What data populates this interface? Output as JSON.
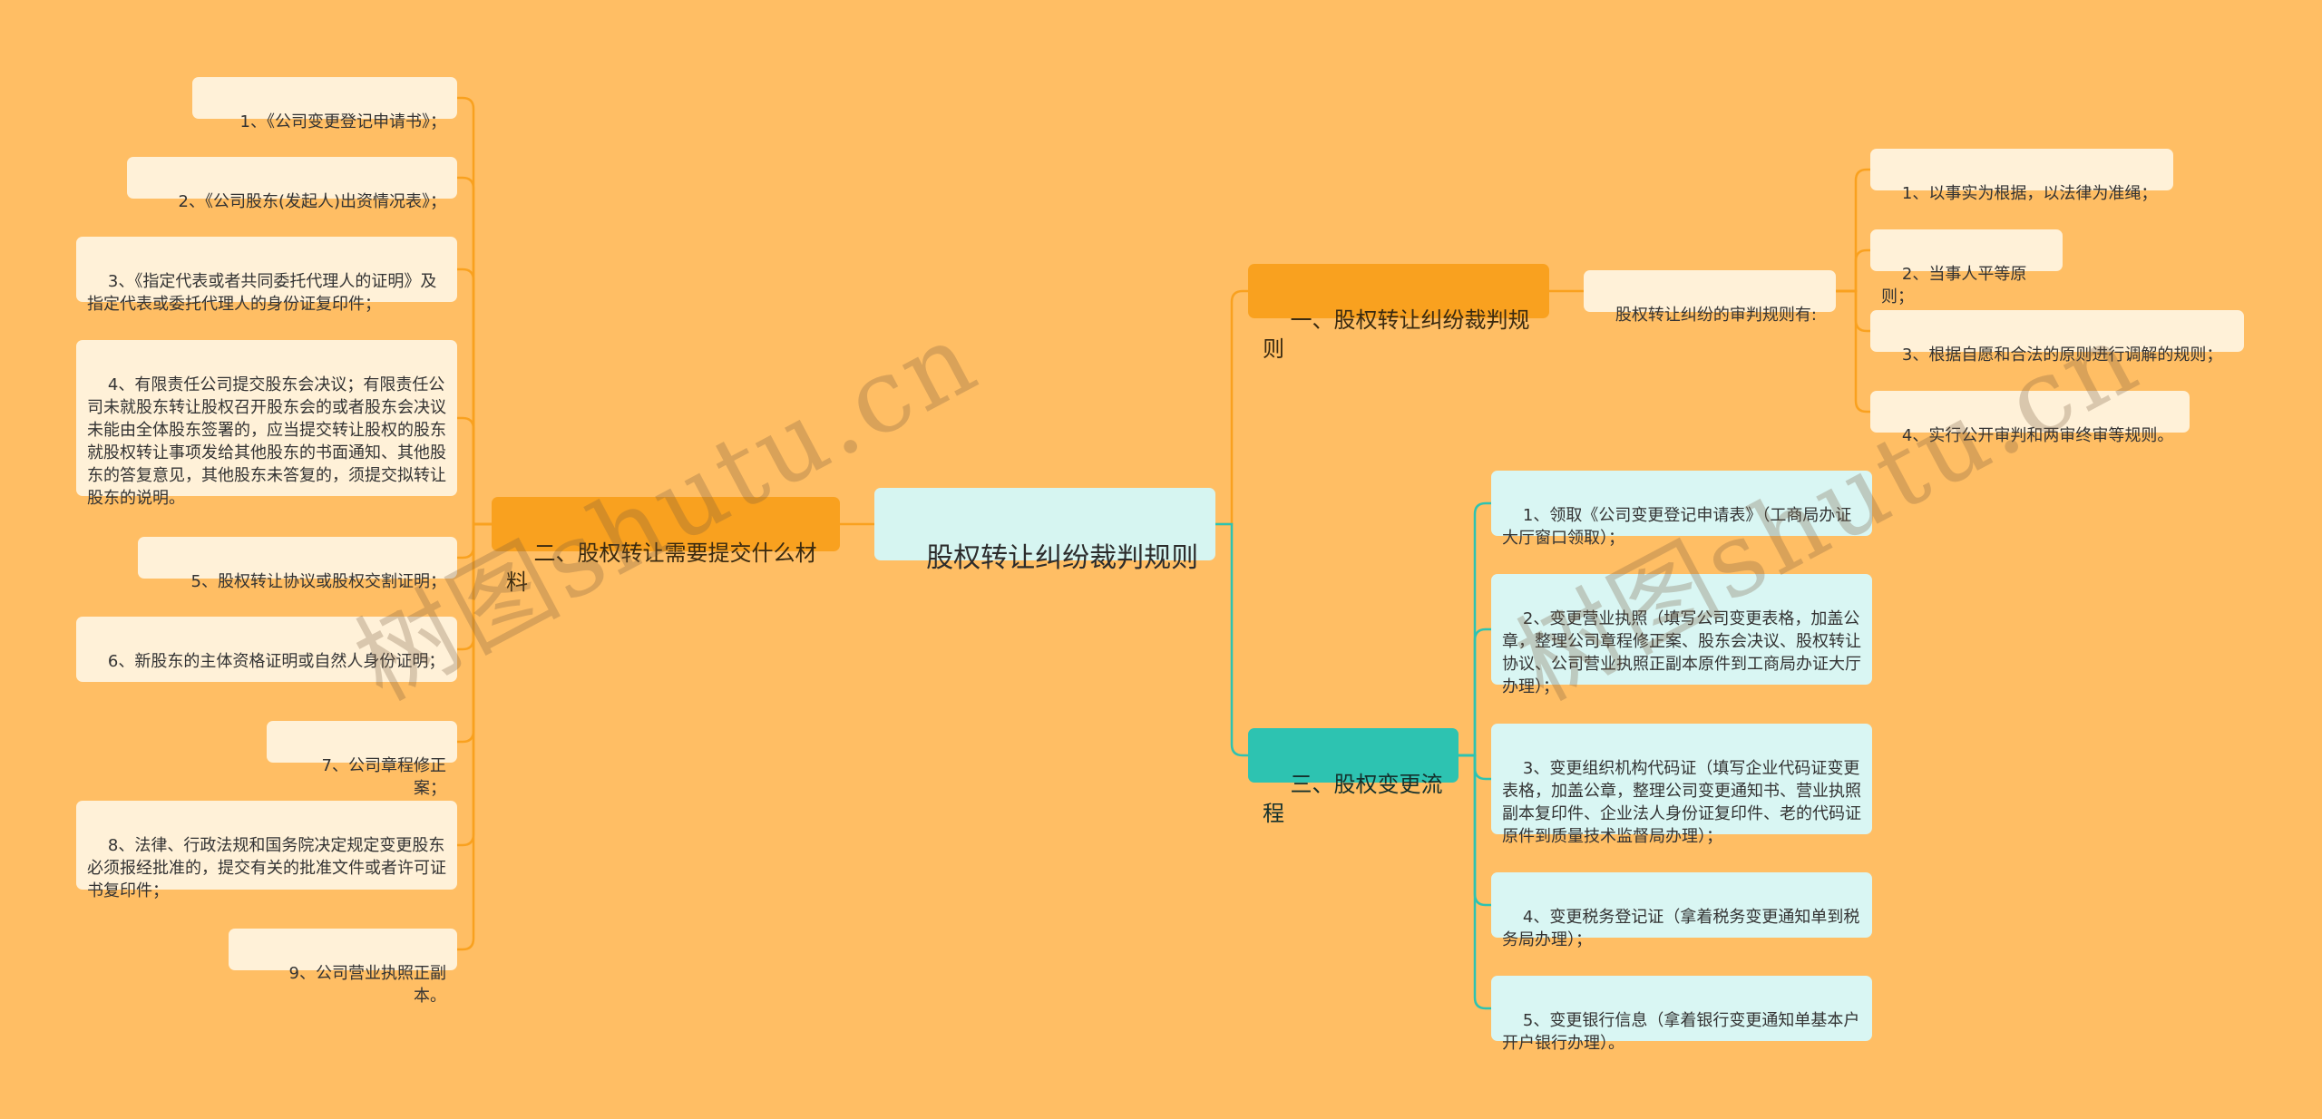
{
  "root": {
    "label": "股权转让纠纷裁判规则"
  },
  "branches": {
    "b1": {
      "label": "一、股权转让纠纷裁判规则",
      "sub": "股权转让纠纷的审判规则有:",
      "items": [
        "1、以事实为根据，以法律为准绳；",
        "2、当事人平等原则；",
        "3、根据自愿和合法的原则进行调解的规则；",
        "4、实行公开审判和两审终审等规则。"
      ]
    },
    "b2": {
      "label": "二、股权转让需要提交什么材料",
      "items": [
        "1、《公司变更登记申请书》；",
        "2、《公司股东(发起人)出资情况表》；",
        "3、《指定代表或者共同委托代理人的证明》及指定代表或委托代理人的身份证复印件；",
        "4、有限责任公司提交股东会决议；有限责任公司未就股东转让股权召开股东会的或者股东会决议未能由全体股东签署的，应当提交转让股权的股东就股权转让事项发给其他股东的书面通知、其他股东的答复意见，其他股东未答复的，须提交拟转让股东的说明。",
        "5、股权转让协议或股权交割证明；",
        "6、新股东的主体资格证明或自然人身份证明；",
        "7、公司章程修正案；",
        "8、法律、行政法规和国务院决定规定变更股东必须报经批准的，提交有关的批准文件或者许可证书复印件；",
        "9、公司营业执照正副本。"
      ]
    },
    "b3": {
      "label": "三、股权变更流程",
      "items": [
        "1、领取《公司变更登记申请表》（工商局办证大厅窗口领取）；",
        "2、变更营业执照（填写公司变更表格，加盖公章，整理公司章程修正案、股东会决议、股权转让协议、公司营业执照正副本原件到工商局办证大厅办理）；",
        "3、变更组织机构代码证（填写企业代码证变更表格，加盖公章，整理公司变更通知书、营业执照副本复印件、企业法人身份证复印件、老的代码证原件到质量技术监督局办理）；",
        "4、变更税务登记证（拿着税务变更通知单到税务局办理）；",
        "5、变更银行信息（拿着银行变更通知单基本户开户银行办理）。"
      ]
    }
  },
  "watermark": {
    "left": "树图shutu.cn",
    "right": "树图shutu.cn"
  },
  "colors": {
    "background": "#ffbe64",
    "orange_branch": "#f9a11f",
    "teal_branch": "#2dc3b1",
    "root_fill": "#d6f5f1",
    "leaf_cream": "#fff1d8",
    "leaf_teal": "#d9f6f3",
    "orange_line": "#f9a11f",
    "teal_line": "#2dc3b1"
  }
}
